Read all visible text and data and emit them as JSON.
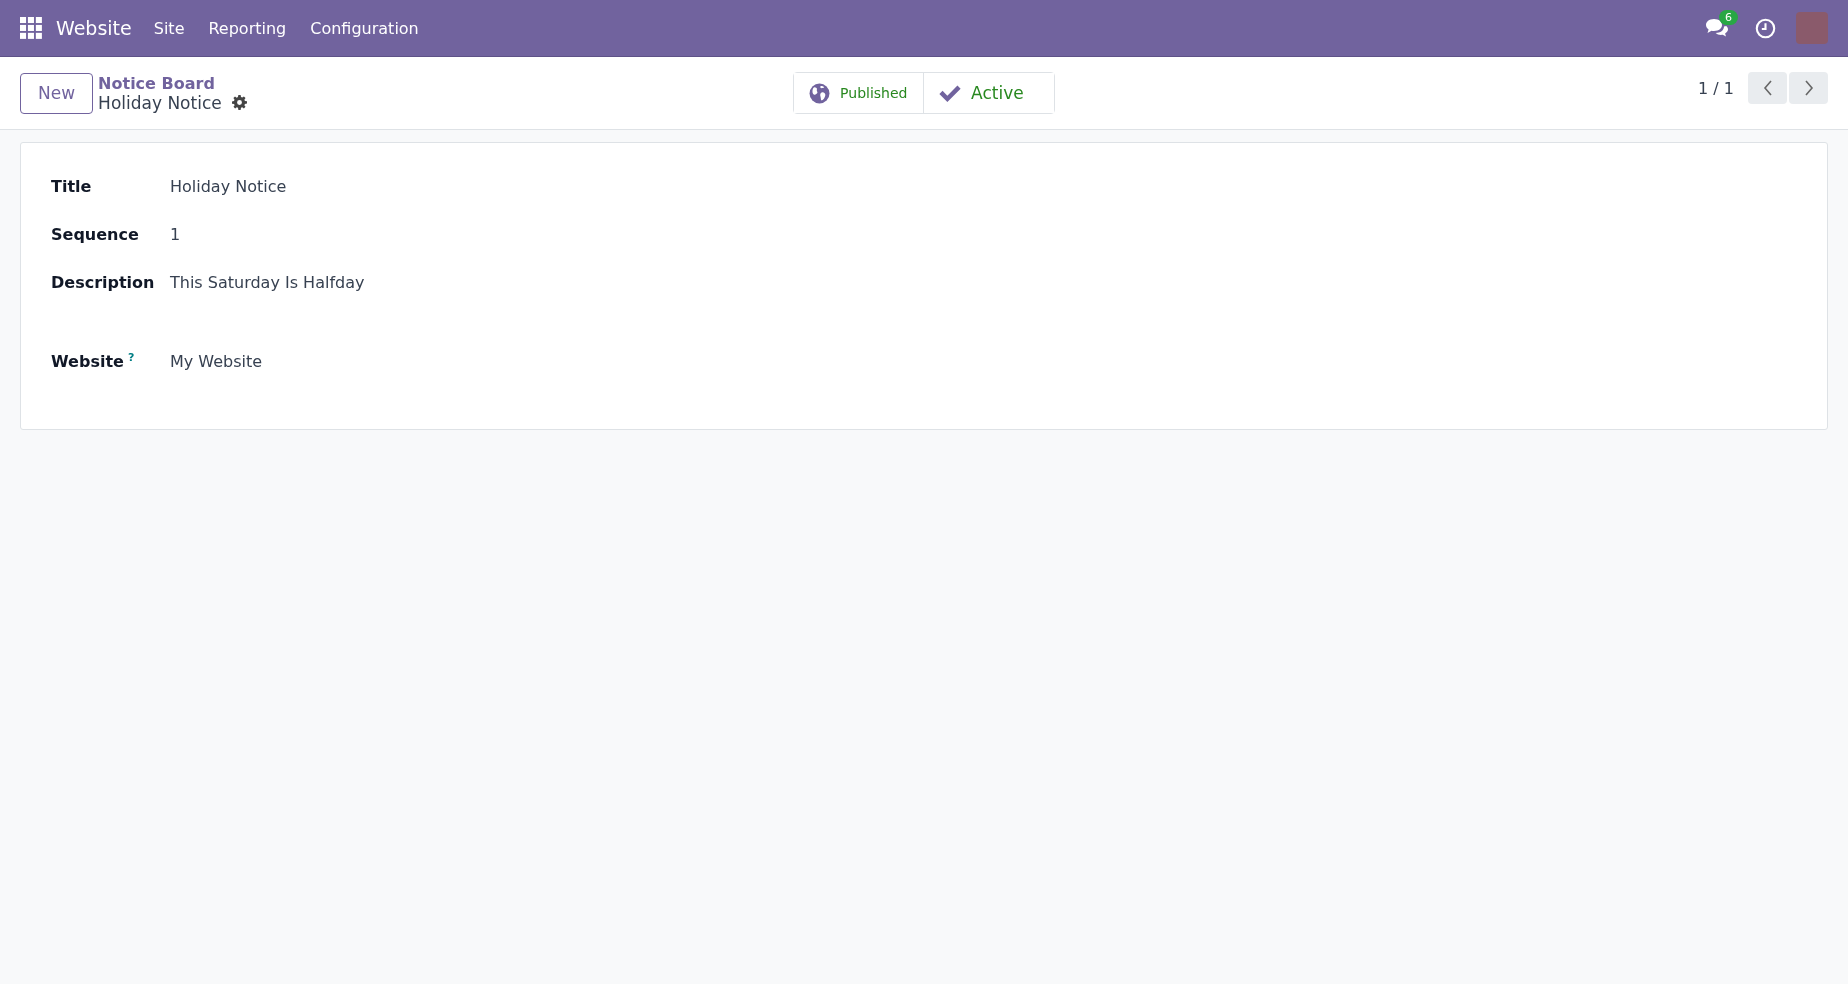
{
  "navbar": {
    "app_name": "Website",
    "menus": [
      "Site",
      "Reporting",
      "Configuration"
    ],
    "messages_badge": "6"
  },
  "control_panel": {
    "new_button": "New",
    "breadcrumb_parent": "Notice Board",
    "breadcrumb_current": "Holiday Notice",
    "pager": "1 / 1"
  },
  "smart_buttons": [
    {
      "kind": "published",
      "label": "Published"
    },
    {
      "kind": "active",
      "label": "Active"
    }
  ],
  "fields": [
    {
      "kind": "char",
      "label": "Title",
      "value": "Holiday Notice"
    },
    {
      "kind": "char",
      "label": "Sequence",
      "value": "1"
    },
    {
      "kind": "html",
      "label": "Description",
      "value": "This Saturday Is Halfday"
    },
    {
      "kind": "char",
      "label": "Website",
      "help": "?",
      "value": "My Website"
    }
  ]
}
